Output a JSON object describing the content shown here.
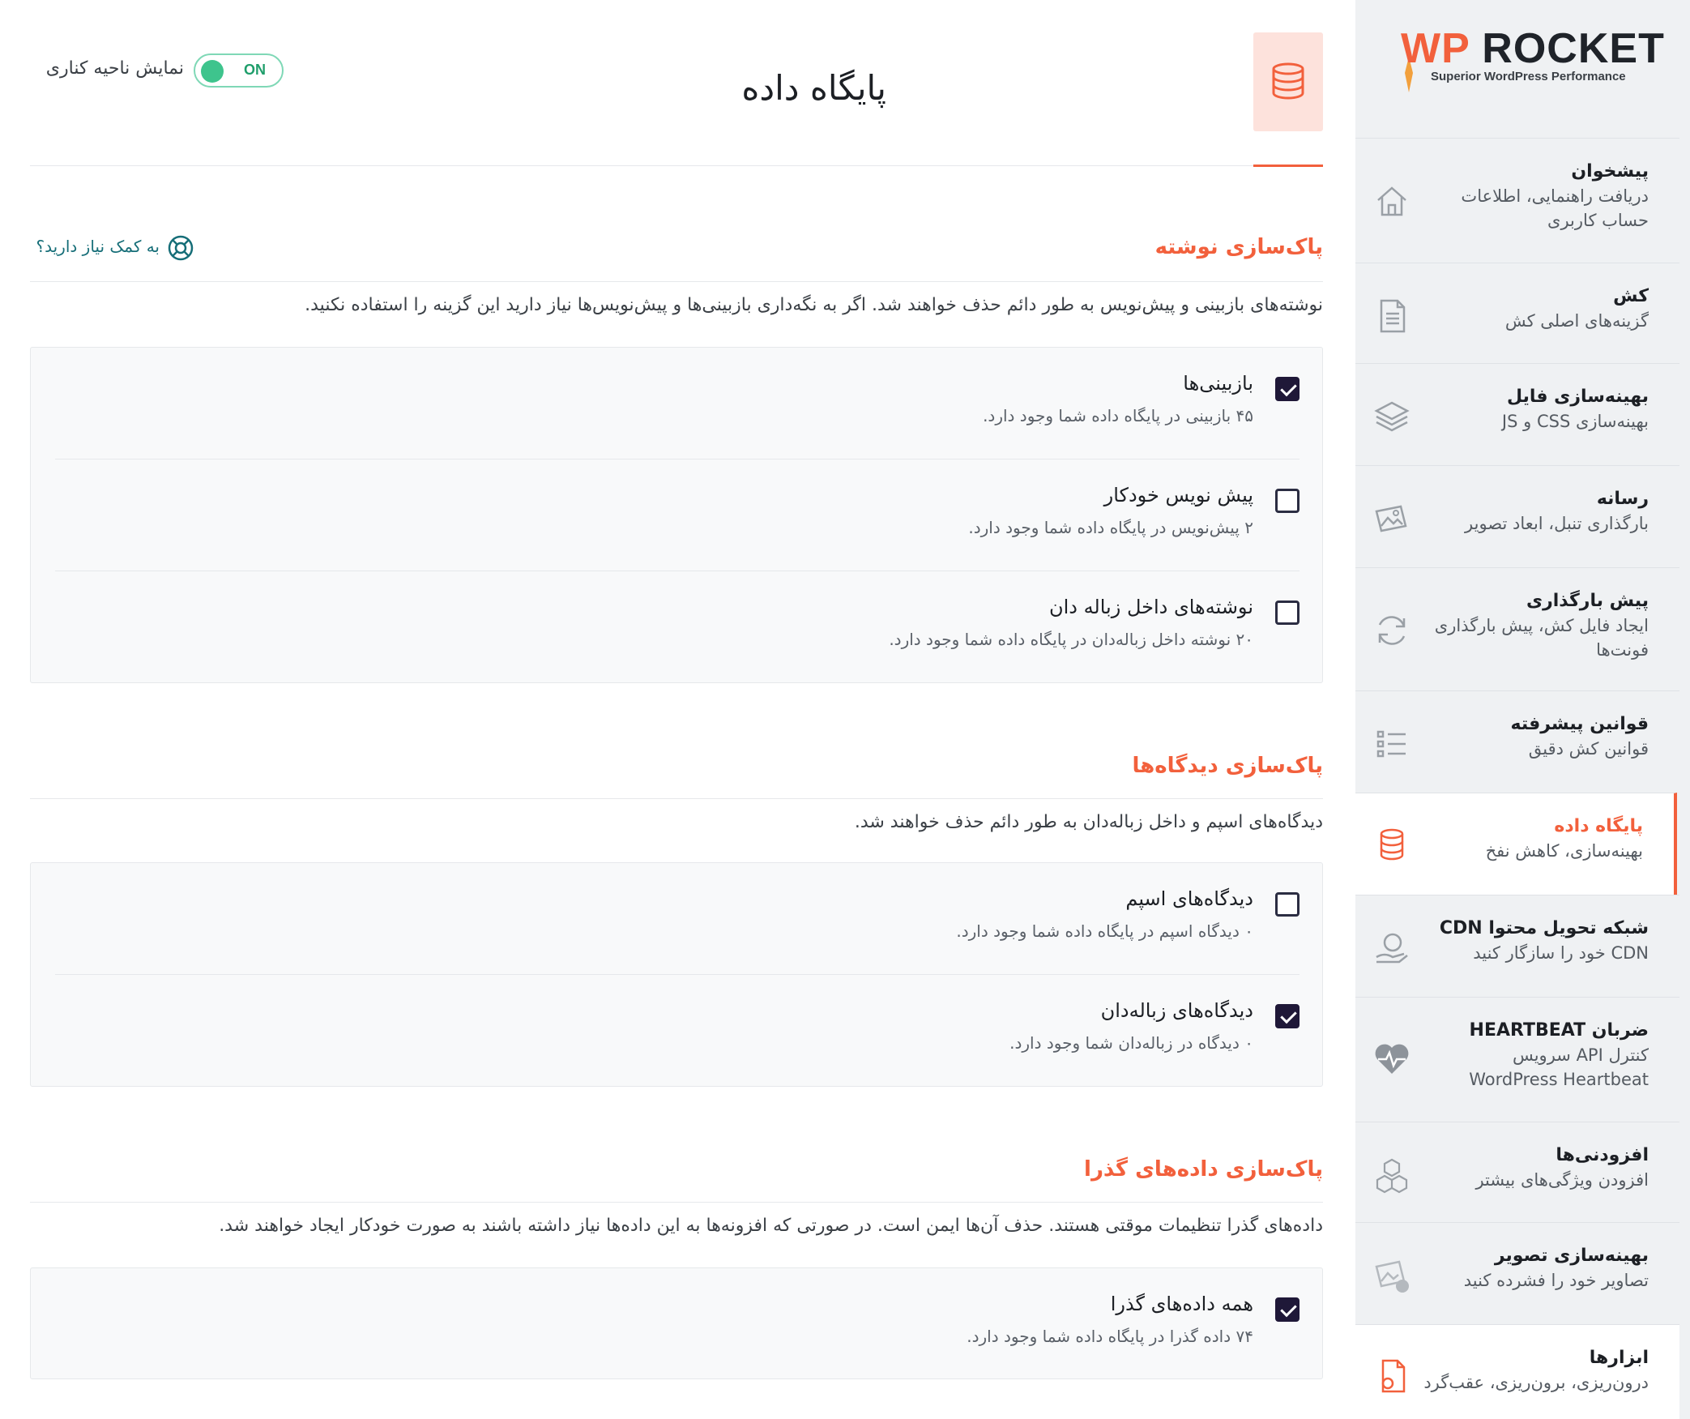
{
  "brand": {
    "logo_wp": "WP",
    "logo_rocket": "ROCKET",
    "tagline": "Superior WordPress Performance",
    "accent_color": "#f2603c"
  },
  "header": {
    "title": "پایگاه داده",
    "icon": "database-icon",
    "sidebar_toggle_label": "نمایش ناحیه کناری",
    "sidebar_toggle_state": "ON",
    "help_link": "به کمک نیاز دارید؟"
  },
  "sidebar": {
    "items": [
      {
        "title": "پیشخوان",
        "desc": "دریافت راهنمایی، اطلاعات حساب کاربری",
        "icon": "home-icon"
      },
      {
        "title": "کش",
        "desc": "گزینه‌های اصلی کش",
        "icon": "document-icon"
      },
      {
        "title": "بهینه‌سازی فایل",
        "desc": "بهینه‌سازی CSS و JS",
        "icon": "layers-icon"
      },
      {
        "title": "رسانه",
        "desc": "بارگذاری تنبل، ابعاد تصویر",
        "icon": "images-icon"
      },
      {
        "title": "پیش بارگذاری",
        "desc": "ایجاد فایل کش، پیش بارگذاری فونت‌ها",
        "icon": "refresh-icon"
      },
      {
        "title": "قوانین پیشرفته",
        "desc": "قوانین کش دقیق",
        "icon": "list-icon"
      },
      {
        "title": "پایگاه داده",
        "desc": "بهینه‌سازی، کاهش نفخ",
        "icon": "database-icon",
        "active": true
      },
      {
        "title": "شبکه تحویل محتوا CDN",
        "desc": "CDN خود را سازگار کنید",
        "icon": "globe-hand-icon"
      },
      {
        "title": "ضربان HEARTBEAT",
        "desc": "کنترل API سرویس WordPress Heartbeat",
        "icon": "heartbeat-icon"
      },
      {
        "title": "افزودنی‌ها",
        "desc": "افزودن ویژگی‌های بیشتر",
        "icon": "cubes-icon"
      },
      {
        "title": "بهینه‌سازی تصویر",
        "desc": "تصاویر خود را فشرده کنید",
        "icon": "image-compress-icon"
      },
      {
        "title": "ابزارها",
        "desc": "درون‌ریزی، برون‌ریزی، عقب‌گرد",
        "icon": "tools-file-icon"
      }
    ]
  },
  "sections": [
    {
      "title": "پاک‌سازی نوشته",
      "desc": "نوشته‌های بازبینی و پیش‌نویس به طور دائم حذف خواهند شد. اگر به نگه‌داری بازبینی‌ها و پیش‌نویس‌ها نیاز دارید این گزینه را استفاده نکنید.",
      "options": [
        {
          "label": "بازبینی‌ها",
          "desc": "۴۵ بازبینی در پایگاه داده شما وجود دارد.",
          "checked": true
        },
        {
          "label": "پیش نویس خودکار",
          "desc": "۲ پیش‌نویس در پایگاه داده شما وجود دارد.",
          "checked": false
        },
        {
          "label": "نوشته‌های داخل زباله دان",
          "desc": "۲۰ نوشته داخل زباله‌دان در پایگاه داده شما وجود دارد.",
          "checked": false
        }
      ]
    },
    {
      "title": "پاک‌سازی دیدگاه‌ها",
      "desc": "دیدگاه‌های اسپم و داخل زباله‌دان به طور دائم حذف خواهند شد.",
      "options": [
        {
          "label": "دیدگاه‌های اسپم",
          "desc": "۰ دیدگاه اسپم در پایگاه داده شما وجود دارد.",
          "checked": false
        },
        {
          "label": "دیدگاه‌های زباله‌دان",
          "desc": "۰ دیدگاه در زباله‌دان شما وجود دارد.",
          "checked": true
        }
      ]
    },
    {
      "title": "پاک‌سازی داده‌های گذرا",
      "desc": "داده‌های گذرا تنظیمات موقتی هستند. حذف آن‌ها ایمن است. در صورتی که افزونه‌ها به این داده‌ها نیاز داشته باشند به صورت خودکار ایجاد خواهند شد.",
      "options": [
        {
          "label": "همه داده‌های گذرا",
          "desc": "۷۴ داده گذرا در پایگاه داده شما وجود دارد.",
          "checked": true
        }
      ]
    }
  ]
}
